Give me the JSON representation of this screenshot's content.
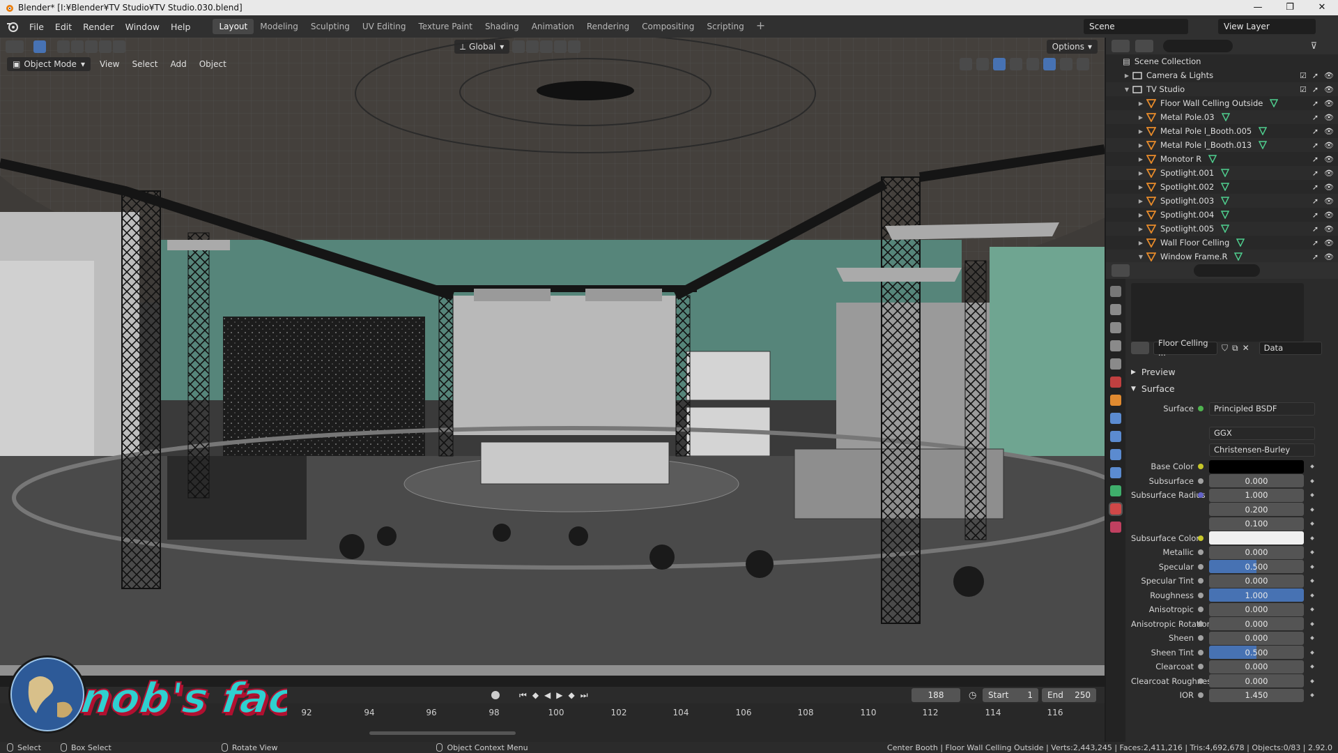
{
  "titlebar": {
    "title": "Blender* [I:¥Blender¥TV Studio¥TV Studio.030.blend]",
    "min": "—",
    "max": "❐",
    "close": "✕"
  },
  "menu": {
    "file": "File",
    "edit": "Edit",
    "render": "Render",
    "window": "Window",
    "help": "Help"
  },
  "workspaces": [
    "Layout",
    "Modeling",
    "Sculpting",
    "UV Editing",
    "Texture Paint",
    "Shading",
    "Animation",
    "Rendering",
    "Compositing",
    "Scripting"
  ],
  "workspace_add": "+",
  "scene": {
    "label": "Scene",
    "view_layer": "View Layer"
  },
  "viewport": {
    "transform_orientation": "Global",
    "options": "Options",
    "mode": "Object Mode",
    "view": "View",
    "select": "Select",
    "add": "Add",
    "object": "Object"
  },
  "timeline": {
    "current_frame": "188",
    "start_label": "Start",
    "start": "1",
    "end_label": "End",
    "end": "250",
    "frames": [
      "92",
      "94",
      "96",
      "98",
      "100",
      "102",
      "104",
      "106",
      "108",
      "110",
      "112",
      "114",
      "116"
    ]
  },
  "outliner": {
    "root": "Scene Collection",
    "items": [
      {
        "label": "Camera & Lights",
        "type": "collection",
        "level": 1
      },
      {
        "label": "TV Studio",
        "type": "collection",
        "level": 1
      },
      {
        "label": "Floor Wall Celling Outside",
        "type": "object",
        "level": 2
      },
      {
        "label": "Metal Pole.03",
        "type": "object",
        "level": 2
      },
      {
        "label": "Metal Pole l_Booth.005",
        "type": "object",
        "level": 2
      },
      {
        "label": "Metal Pole l_Booth.013",
        "type": "object",
        "level": 2
      },
      {
        "label": "Monotor R",
        "type": "object",
        "level": 2
      },
      {
        "label": "Spotlight.001",
        "type": "object",
        "level": 2
      },
      {
        "label": "Spotlight.002",
        "type": "object",
        "level": 2
      },
      {
        "label": "Spotlight.003",
        "type": "object",
        "level": 2
      },
      {
        "label": "Spotlight.004",
        "type": "object",
        "level": 2
      },
      {
        "label": "Spotlight.005",
        "type": "object",
        "level": 2
      },
      {
        "label": "Wall Floor Celling",
        "type": "object",
        "level": 2
      },
      {
        "label": "Window Frame.R",
        "type": "object",
        "level": 2
      }
    ]
  },
  "properties": {
    "material_name": "Floor Celling ...",
    "link": "Data",
    "preview": "Preview",
    "surface_panel": "Surface",
    "surface_label": "Surface",
    "shader": "Principled BSDF",
    "distribution": "GGX",
    "subsurface_method": "Christensen-Burley",
    "rows": [
      {
        "label": "Base Color",
        "value": "",
        "kind": "color",
        "color": "#000000",
        "dot": "yellow"
      },
      {
        "label": "Subsurface",
        "value": "0.000",
        "kind": "num",
        "fill": 0,
        "dot": "grey"
      },
      {
        "label": "Subsurface Radius",
        "value": "1.000",
        "kind": "num",
        "fill": 0,
        "dot": "purple"
      },
      {
        "label": "",
        "value": "0.200",
        "kind": "num",
        "fill": 0,
        "dot": ""
      },
      {
        "label": "",
        "value": "0.100",
        "kind": "num",
        "fill": 0,
        "dot": ""
      },
      {
        "label": "Subsurface Color",
        "value": "",
        "kind": "color",
        "color": "#f0f0f0",
        "dot": "yellow"
      },
      {
        "label": "Metallic",
        "value": "0.000",
        "kind": "num",
        "fill": 0,
        "dot": "grey"
      },
      {
        "label": "Specular",
        "value": "0.500",
        "kind": "num",
        "fill": 0.5,
        "dot": "grey"
      },
      {
        "label": "Specular Tint",
        "value": "0.000",
        "kind": "num",
        "fill": 0,
        "dot": "grey"
      },
      {
        "label": "Roughness",
        "value": "1.000",
        "kind": "num",
        "fill": 1,
        "dot": "grey"
      },
      {
        "label": "Anisotropic",
        "value": "0.000",
        "kind": "num",
        "fill": 0,
        "dot": "grey"
      },
      {
        "label": "Anisotropic Rotation",
        "value": "0.000",
        "kind": "num",
        "fill": 0,
        "dot": "grey"
      },
      {
        "label": "Sheen",
        "value": "0.000",
        "kind": "num",
        "fill": 0,
        "dot": "grey"
      },
      {
        "label": "Sheen Tint",
        "value": "0.500",
        "kind": "num",
        "fill": 0.5,
        "dot": "grey"
      },
      {
        "label": "Clearcoat",
        "value": "0.000",
        "kind": "num",
        "fill": 0,
        "dot": "grey"
      },
      {
        "label": "Clearcoat Roughness",
        "value": "0.000",
        "kind": "num",
        "fill": 0,
        "dot": "grey"
      },
      {
        "label": "IOR",
        "value": "1.450",
        "kind": "num",
        "fill": 0,
        "dot": "grey"
      }
    ]
  },
  "statusbar": {
    "select": "Select",
    "box_select": "Box Select",
    "rotate_view": "Rotate View",
    "context_menu": "Object Context Menu",
    "stats": "Center Booth | Floor Wall Celling Outside | Verts:2,443,245 | Faces:2,411,216 | Tris:4,692,678 | Objects:0/83 | 2.92.0"
  },
  "watermark": {
    "text": "nob's factory"
  }
}
